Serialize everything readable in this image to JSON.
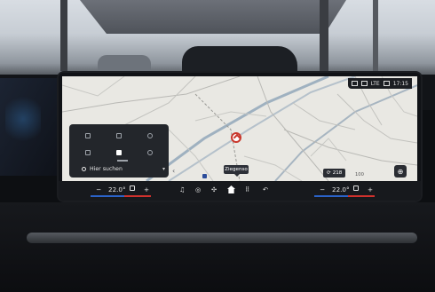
{
  "status": {
    "network": "LTE",
    "time": "17:15"
  },
  "widget": {
    "search_placeholder": "Hier suchen"
  },
  "map": {
    "location_label": "Ziegenso",
    "scale_value": "218",
    "distance_value": "100"
  },
  "climate": {
    "driver_temp": "22.0°",
    "passenger_temp": "22.0°",
    "minus": "−",
    "plus": "+"
  },
  "icons": {
    "status": [
      "sound-icon",
      "phone-icon",
      "network-icon",
      "volume-icon"
    ],
    "widget": [
      "media-icon",
      "phone-icon",
      "car-icon",
      "apps-icon",
      "seat-icon",
      "settings-icon"
    ],
    "bar": [
      "seat-heat-icon",
      "music-icon",
      "nav-icon",
      "fan-icon",
      "home-icon",
      "menu-icon",
      "back-icon",
      "seat-heat-icon"
    ]
  },
  "colors": {
    "accent_blue": "#2b63c9",
    "accent_red": "#d0312d",
    "map_bg": "#e9e8e3"
  }
}
